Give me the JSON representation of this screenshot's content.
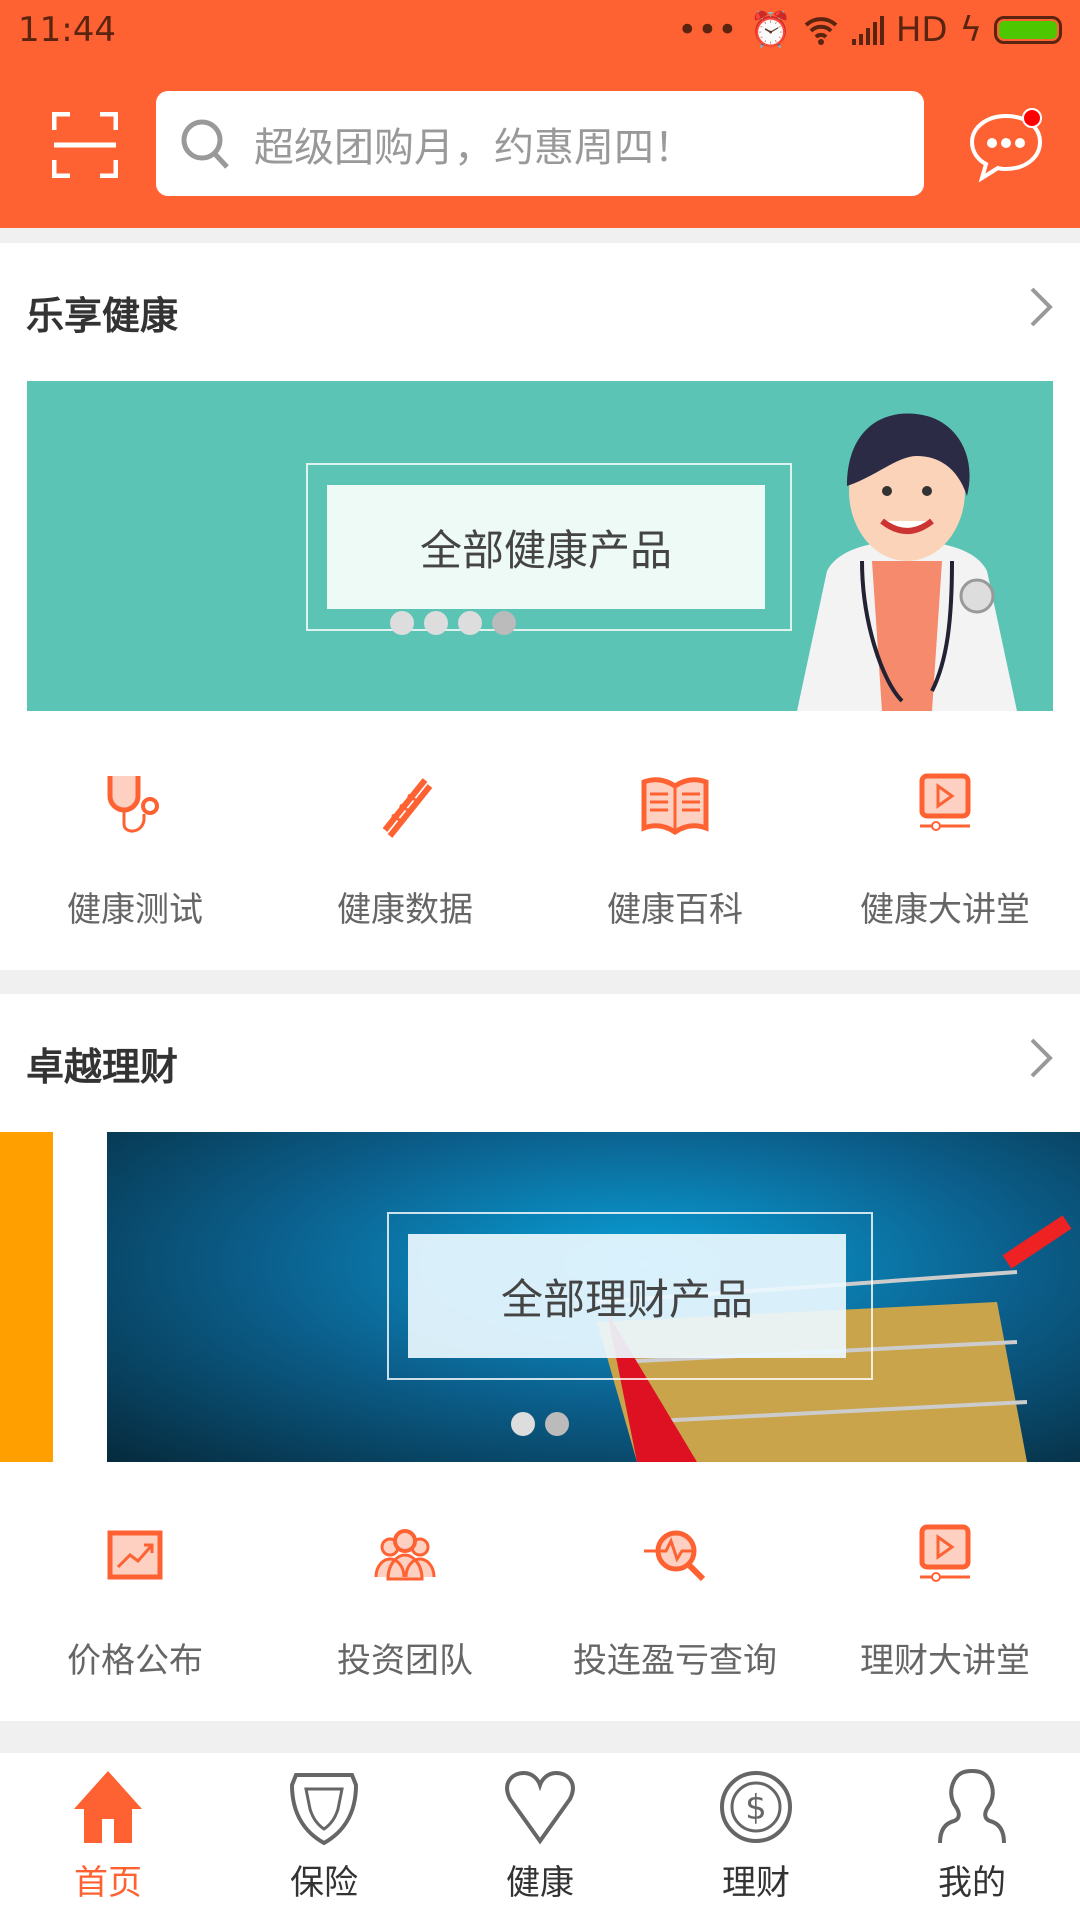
{
  "status_bar": {
    "time": "11:44",
    "network": "HD",
    "icons": [
      "more-dots-icon",
      "alarm-icon",
      "wifi-icon",
      "signal-icon",
      "charging-icon",
      "battery-icon"
    ],
    "battery_level": 0.95
  },
  "header": {
    "search_placeholder": "超级团购月，约惠周四！",
    "accent": "#ff6232",
    "has_unread_message": true
  },
  "health": {
    "title": "乐享健康",
    "banner_label": "全部健康产品",
    "banner_color": "#5bc4b5",
    "banner_pages": 4,
    "banner_active": 3,
    "items": [
      {
        "label": "健康测试",
        "icon": "stethoscope-icon"
      },
      {
        "label": "健康数据",
        "icon": "dna-icon"
      },
      {
        "label": "健康百科",
        "icon": "book-icon"
      },
      {
        "label": "健康大讲堂",
        "icon": "video-lecture-icon"
      }
    ]
  },
  "finance": {
    "title": "卓越理财",
    "banner_label": "全部理财产品",
    "banner_pages": 2,
    "banner_active": 0,
    "items": [
      {
        "label": "价格公布",
        "icon": "chart-icon"
      },
      {
        "label": "投资团队",
        "icon": "team-icon"
      },
      {
        "label": "投连盈亏查询",
        "icon": "search-chart-icon"
      },
      {
        "label": "理财大讲堂",
        "icon": "video-lecture-icon"
      }
    ]
  },
  "nav": {
    "items": [
      {
        "label": "首页",
        "icon": "home-icon",
        "active": true
      },
      {
        "label": "保险",
        "icon": "shield-icon"
      },
      {
        "label": "健康",
        "icon": "heart-icon"
      },
      {
        "label": "理财",
        "icon": "coin-icon"
      },
      {
        "label": "我的",
        "icon": "user-icon"
      }
    ]
  }
}
